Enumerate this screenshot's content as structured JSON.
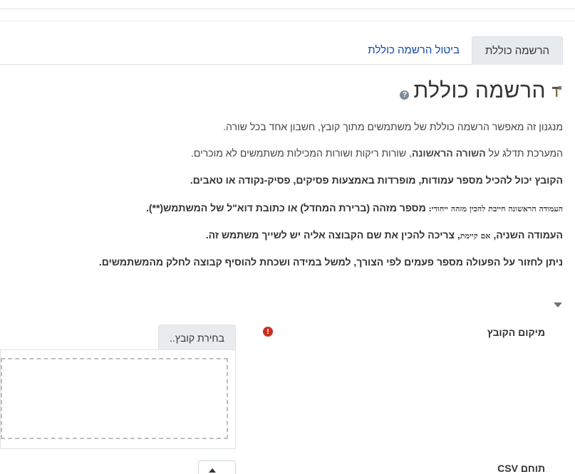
{
  "tabs": [
    {
      "label": "הרשמה כוללת",
      "active": true
    },
    {
      "label": "ביטול הרשמה כוללת",
      "active": false
    }
  ],
  "heading": {
    "title": "הרשמה כוללת",
    "icon": "hammer-icon",
    "help_icon": "question-icon",
    "help_glyph": "?"
  },
  "paragraphs": {
    "p1": "מנגנון זה מאפשר הרשמה כוללת של משתמשים מתוך קובץ, חשבון אחד בכל שורה.",
    "p2_pre": "המערכת תדלג על ",
    "p2_bold": "השורה הראשונה",
    "p2_post": ", שורות ריקות ושורות המכילות משתמשים לא מוכרים.",
    "p3": "הקובץ יכול להכיל מספר עמודות, מופרדות באמצעות פסיקים, פסיק-נקודה או טאבים.",
    "p4_small": "העמודה הראשונה חייבת להכין מזהה ייחודי:",
    "p4_rest": " מספר מזהה (ברירת המחדל) או כתובת דוא\"ל של המשתמש(**).",
    "p5_pre": "העמודה השניה, ",
    "p5_small": "אם קיימת",
    "p5_post": ", צריכה להכין את שם הקבוצה אליה יש לשייך משתמש זה.",
    "p6": "ניתן לחזור על הפעולה מספר פעמים לפי הצורך, למשל במידה ושכחת להוסיף קבוצה לחלק מהמשתמשים."
  },
  "form": {
    "file_label": "מיקום הקובץ",
    "required_glyph": "!",
    "choose_file_label": "בחירת קובץ..",
    "csv_label": "תוחם CSV"
  },
  "colors": {
    "link": "#0f47ad",
    "required": "#ca3120",
    "tab_active_bg": "#e7ebee"
  }
}
